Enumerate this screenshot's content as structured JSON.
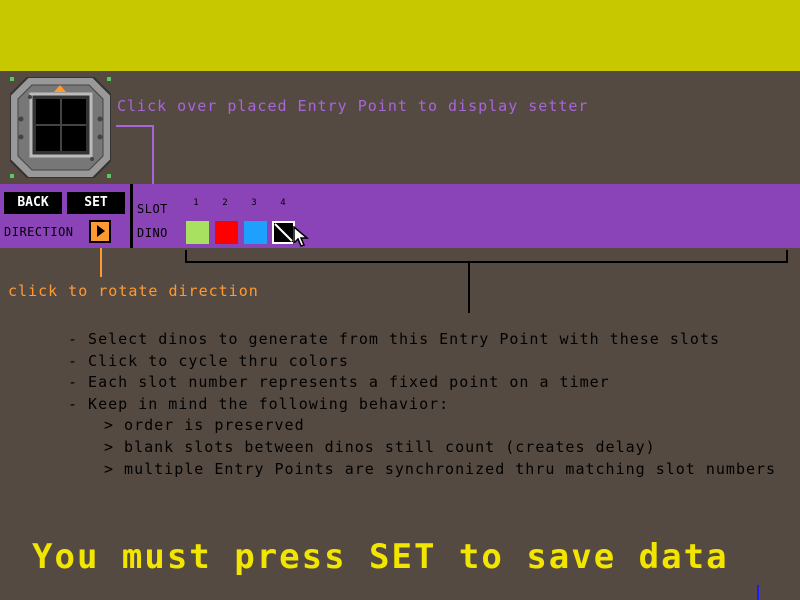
{
  "colors": {
    "top_bar": "#c8c800",
    "background": "#554a42",
    "panel": "#8b43b8",
    "hint_purple": "#a865d8",
    "hint_orange": "#ff9a33",
    "notice_yellow": "#f2e600"
  },
  "entry_point": {
    "icon": "entry-point-tile-icon"
  },
  "hints": {
    "setter": "Click over placed Entry Point to display setter",
    "rotate": "click to rotate direction"
  },
  "panel": {
    "back_label": "BACK",
    "set_label": "SET",
    "direction_label": "DIRECTION",
    "direction_icon": "arrow-right-icon",
    "slot_label": "SLOT",
    "dino_label": "DINO",
    "slots": [
      {
        "number": "1",
        "color": "#a8e060"
      },
      {
        "number": "2",
        "color": "#ff0000"
      },
      {
        "number": "3",
        "color": "#1ea0ff"
      },
      {
        "number": "4",
        "color": "blank"
      }
    ]
  },
  "instructions": [
    "- Select dinos to generate from this Entry Point with these slots",
    "- Click to cycle thru colors",
    "- Each slot number represents a fixed point on a timer",
    "- Keep in mind the following behavior:"
  ],
  "behaviors": [
    "> order is preserved",
    "> blank slots between dinos still count (creates delay)",
    "> multiple Entry Points are synchronized thru matching slot numbers"
  ],
  "notice": "You must press SET to save data"
}
